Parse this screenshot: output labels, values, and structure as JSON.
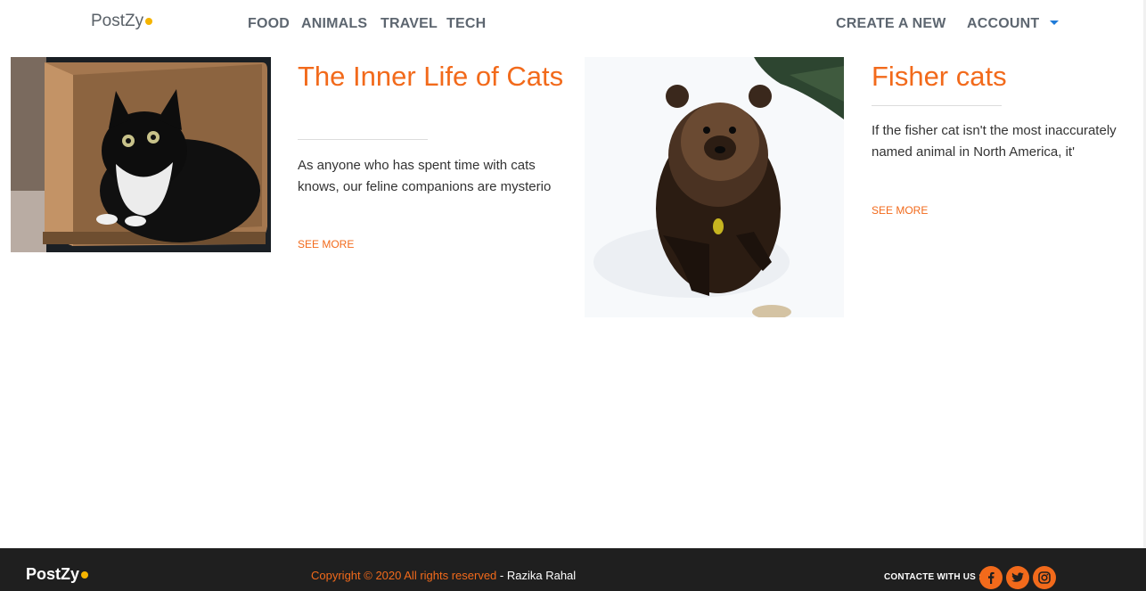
{
  "brand": {
    "name": "PostZy"
  },
  "nav": {
    "categories": [
      "FOOD",
      "ANIMALS",
      "TRAVEL",
      "TECH"
    ],
    "create_label": "CREATE A NEW",
    "account_label": "ACCOUNT"
  },
  "posts": [
    {
      "title": "The Inner Life of Cats",
      "excerpt": "As anyone who has spent time with cats knows, our feline companions are mysterio",
      "more_label": "SEE MORE"
    },
    {
      "title": "Fisher cats",
      "excerpt": "If the fisher cat isn't the most inaccurately named animal in North America, it'",
      "more_label": "SEE MORE"
    }
  ],
  "footer": {
    "brand": "PostZy",
    "copyright": "Copyright © 2020 All rights reserved",
    "author": "- Razika Rahal",
    "contact_label": "CONTACTE WITH US :",
    "social": [
      "facebook-icon",
      "twitter-icon",
      "instagram-icon"
    ]
  },
  "colors": {
    "accent": "#f26a1b",
    "brand_dot": "#f5b400",
    "footer_bg": "#1f1f1f",
    "nav_text": "#5d6670"
  }
}
